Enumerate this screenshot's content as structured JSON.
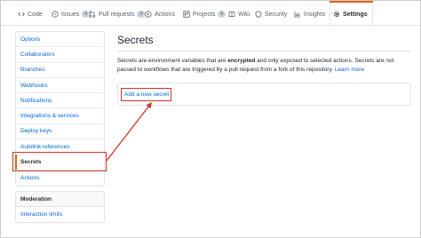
{
  "nav": {
    "tabs": [
      {
        "label": "Code",
        "icon": "code-icon"
      },
      {
        "label": "Issues",
        "icon": "issue-icon",
        "count": "0"
      },
      {
        "label": "Pull requests",
        "icon": "pull-request-icon",
        "count": "0"
      },
      {
        "label": "Actions",
        "icon": "play-icon"
      },
      {
        "label": "Projects",
        "icon": "project-icon",
        "count": "0"
      },
      {
        "label": "Wiki",
        "icon": "book-icon"
      },
      {
        "label": "Security",
        "icon": "shield-icon"
      },
      {
        "label": "Insights",
        "icon": "graph-icon"
      },
      {
        "label": "Settings",
        "icon": "gear-icon"
      }
    ]
  },
  "sidebar": {
    "items": [
      {
        "label": "Options"
      },
      {
        "label": "Collaborators"
      },
      {
        "label": "Branches"
      },
      {
        "label": "Webhooks"
      },
      {
        "label": "Notifications"
      },
      {
        "label": "Integrations & services"
      },
      {
        "label": "Deploy keys"
      },
      {
        "label": "Autolink references"
      },
      {
        "label": "Secrets"
      },
      {
        "label": "Actions"
      }
    ],
    "moderation": {
      "heading": "Moderation",
      "items": [
        {
          "label": "Interaction limits"
        }
      ]
    }
  },
  "main": {
    "title": "Secrets",
    "desc_1": "Secrets are environment variables that are ",
    "desc_bold": "encrypted",
    "desc_2": " and only exposed to selected actions. Secrets are not passed to workflows that are triggered by a pull request from a fork of this repository. ",
    "learn_more": "Learn more",
    "add_secret": "Add a new secret"
  },
  "colors": {
    "link": "#0366d6",
    "annotation": "#d0342c",
    "selected_tab_accent": "#e36209"
  }
}
